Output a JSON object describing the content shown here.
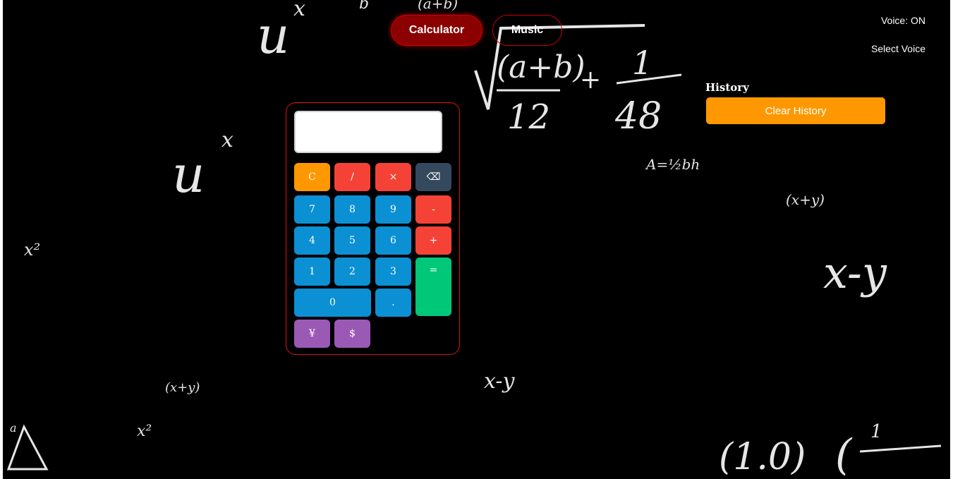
{
  "nav": {
    "calculator_label": "Calculator",
    "music_label": "Music"
  },
  "voice": {
    "status": "Voice: ON",
    "select_label": "Select Voice"
  },
  "history": {
    "title": "History",
    "clear_label": "Clear History"
  },
  "calculator": {
    "display_value": "",
    "keys": {
      "clear": "C",
      "divide": "/",
      "multiply": "×",
      "backspace": "⌫",
      "seven": "7",
      "eight": "8",
      "nine": "9",
      "minus": "-",
      "four": "4",
      "five": "5",
      "six": "6",
      "plus": "+",
      "one": "1",
      "two": "2",
      "three": "3",
      "equals": "=",
      "zero": "0",
      "decimal": ".",
      "yen": "¥",
      "dollar": "$"
    }
  },
  "colors": {
    "background": "#000000",
    "accent_red": "#8b0000",
    "clear_history": "#ff9800",
    "number_key": "#0b90d4",
    "operator_key": "#f44336",
    "equals_key": "#00c878",
    "currency_key": "#9b59b6",
    "backspace_key": "#34495e"
  }
}
